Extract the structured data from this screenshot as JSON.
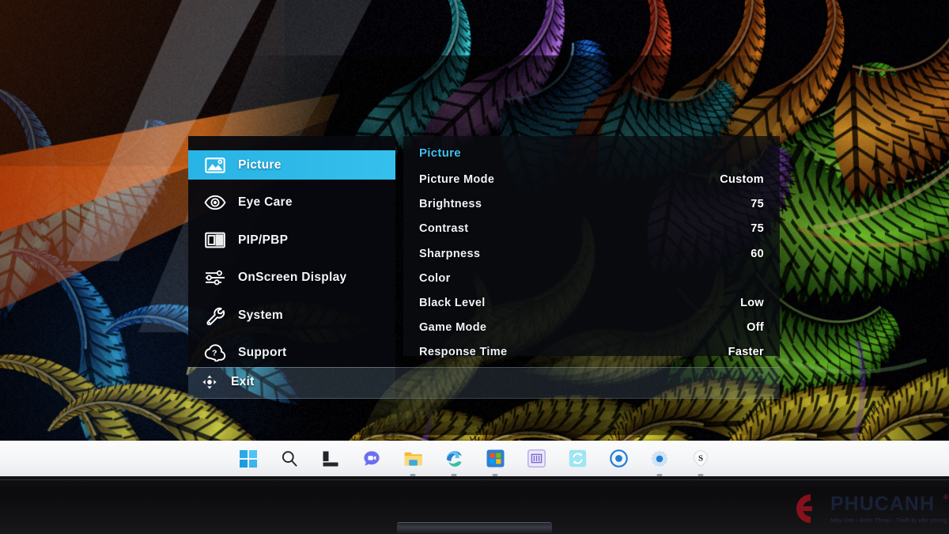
{
  "osd": {
    "sidebar": {
      "items": [
        {
          "label": "Picture",
          "icon": "image-icon",
          "selected": true
        },
        {
          "label": "Eye  Care",
          "icon": "eye-icon",
          "selected": false
        },
        {
          "label": "PIP/PBP",
          "icon": "pip-icon",
          "selected": false
        },
        {
          "label": "OnScreen  Display",
          "icon": "sliders-icon",
          "selected": false
        },
        {
          "label": "System",
          "icon": "wrench-icon",
          "selected": false
        },
        {
          "label": "Support",
          "icon": "help-cloud-icon",
          "selected": false
        }
      ],
      "exit": {
        "label": "Exit",
        "icon": "dpad-icon"
      }
    },
    "panel": {
      "title": "Picture",
      "rows": [
        {
          "label": "Picture  Mode",
          "value": "Custom"
        },
        {
          "label": "Brightness",
          "value": "75"
        },
        {
          "label": "Contrast",
          "value": "75"
        },
        {
          "label": "Sharpness",
          "value": "60"
        },
        {
          "label": "Color",
          "value": ""
        },
        {
          "label": "Black  Level",
          "value": "Low"
        },
        {
          "label": "Game  Mode",
          "value": "Off"
        },
        {
          "label": "Response  Time",
          "value": "Faster"
        }
      ]
    },
    "colors": {
      "highlight": "#2fb9e8",
      "title": "#3fc0ef",
      "panel_bg": "#0a0c12",
      "text": "#f2f6fa"
    }
  },
  "taskbar": {
    "items": [
      {
        "name": "start-icon",
        "label": "Start",
        "running": false
      },
      {
        "name": "search-icon",
        "label": "Search",
        "running": false
      },
      {
        "name": "task-view-icon",
        "label": "Task View",
        "running": false
      },
      {
        "name": "chat-icon",
        "label": "Chat",
        "running": false
      },
      {
        "name": "file-explorer-icon",
        "label": "File Explorer",
        "running": true
      },
      {
        "name": "edge-icon",
        "label": "Microsoft Edge",
        "running": true
      },
      {
        "name": "microsoft-store-icon",
        "label": "Microsoft Store",
        "running": true
      },
      {
        "name": "ruler-app-icon",
        "label": "Measure",
        "running": false
      },
      {
        "name": "sync-app-icon",
        "label": "Sync",
        "running": false
      },
      {
        "name": "target-app-icon",
        "label": "Recorder",
        "running": false
      },
      {
        "name": "settings-gear-icon",
        "label": "Settings",
        "running": true
      },
      {
        "name": "snipaste-icon",
        "label": "S",
        "running": true
      }
    ]
  },
  "watermark": {
    "brand": "PHUCANH",
    "tagline": "Máy tính - Điện Thoại - Thiết bị văn phòng",
    "registered": "®",
    "mark_color": "#a8121f"
  }
}
